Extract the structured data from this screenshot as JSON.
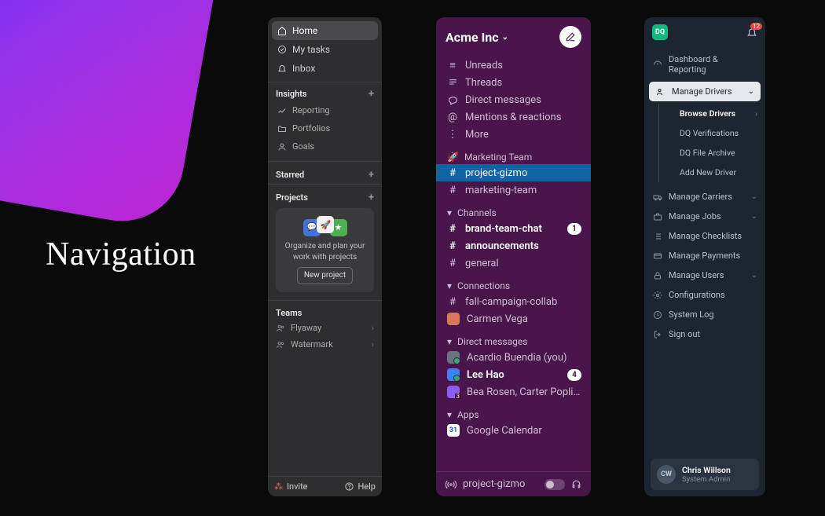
{
  "title": "Navigation",
  "panelA": {
    "nav": [
      {
        "icon": "home",
        "label": "Home",
        "active": true
      },
      {
        "icon": "check",
        "label": "My tasks"
      },
      {
        "icon": "bell",
        "label": "Inbox"
      }
    ],
    "insights": {
      "head": "Insights",
      "items": [
        {
          "icon": "chart",
          "label": "Reporting"
        },
        {
          "icon": "folder",
          "label": "Portfolios"
        },
        {
          "icon": "person",
          "label": "Goals"
        }
      ]
    },
    "starred": {
      "head": "Starred"
    },
    "projects": {
      "head": "Projects",
      "card_text": "Organize and plan your work with projects",
      "button": "New project"
    },
    "teams": {
      "head": "Teams",
      "items": [
        "Flyaway",
        "Watermark"
      ]
    },
    "footer": {
      "invite": "Invite",
      "help": "Help"
    }
  },
  "panelB": {
    "workspace": "Acme Inc",
    "top": [
      {
        "icon": "unreads",
        "label": "Unreads"
      },
      {
        "icon": "threads",
        "label": "Threads"
      },
      {
        "icon": "dm",
        "label": "Direct messages"
      },
      {
        "icon": "mentions",
        "label": "Mentions & reactions"
      },
      {
        "icon": "more",
        "label": "More"
      }
    ],
    "marketing": {
      "head": "Marketing Team",
      "items": [
        {
          "label": "project-gizmo",
          "selected": true
        },
        {
          "label": "marketing-team"
        }
      ]
    },
    "channels": {
      "head": "Channels",
      "items": [
        {
          "label": "brand-team-chat",
          "bold": true,
          "badge": "1"
        },
        {
          "label": "announcements",
          "bold": true
        },
        {
          "label": "general"
        }
      ]
    },
    "connections": {
      "head": "Connections",
      "items": [
        {
          "type": "channel",
          "label": "fall-campaign-collab"
        },
        {
          "type": "person",
          "label": "Carmen Vega",
          "avatar": "#d97757"
        }
      ]
    },
    "dms": {
      "head": "Direct messages",
      "items": [
        {
          "label": "Acardio Buendia (you)",
          "avatar": "#6b7280",
          "presence": "online"
        },
        {
          "label": "Lee Hao",
          "bold": true,
          "badge": "4",
          "avatar": "#3b82f6",
          "presence": "online"
        },
        {
          "label": "Bea Rosen, Carter Poplin...",
          "avatar": "#8b5cf6",
          "count": "3"
        }
      ]
    },
    "apps": {
      "head": "Apps",
      "items": [
        {
          "label": "Google Calendar",
          "avatar": "#185abc",
          "iconbg": "#fff"
        }
      ]
    },
    "huddle": {
      "label": "project-gizmo"
    }
  },
  "panelC": {
    "logo": "DQ",
    "notif": "12",
    "nav": [
      {
        "icon": "dash",
        "label": "Dashboard & Reporting"
      },
      {
        "icon": "drivers",
        "label": "Manage Drivers",
        "expanded": true,
        "sub": [
          {
            "label": "Browse Drivers",
            "active": true,
            "chev": true
          },
          {
            "label": "DQ Verifications"
          },
          {
            "label": "DQ File Archive"
          },
          {
            "label": "Add New Driver"
          }
        ]
      },
      {
        "icon": "truck",
        "label": "Manage Carriers",
        "chev": true
      },
      {
        "icon": "briefcase",
        "label": "Manage Jobs",
        "chev": true
      },
      {
        "icon": "list",
        "label": "Manage Checklists"
      },
      {
        "icon": "card",
        "label": "Manage Payments"
      },
      {
        "icon": "lock",
        "label": "Manage Users",
        "chev": true
      },
      {
        "icon": "gear",
        "label": "Configurations"
      },
      {
        "icon": "clock",
        "label": "System Log"
      },
      {
        "icon": "signout",
        "label": "Sign out"
      }
    ],
    "user": {
      "initials": "CW",
      "name": "Chris Willson",
      "role": "System Admin"
    }
  }
}
